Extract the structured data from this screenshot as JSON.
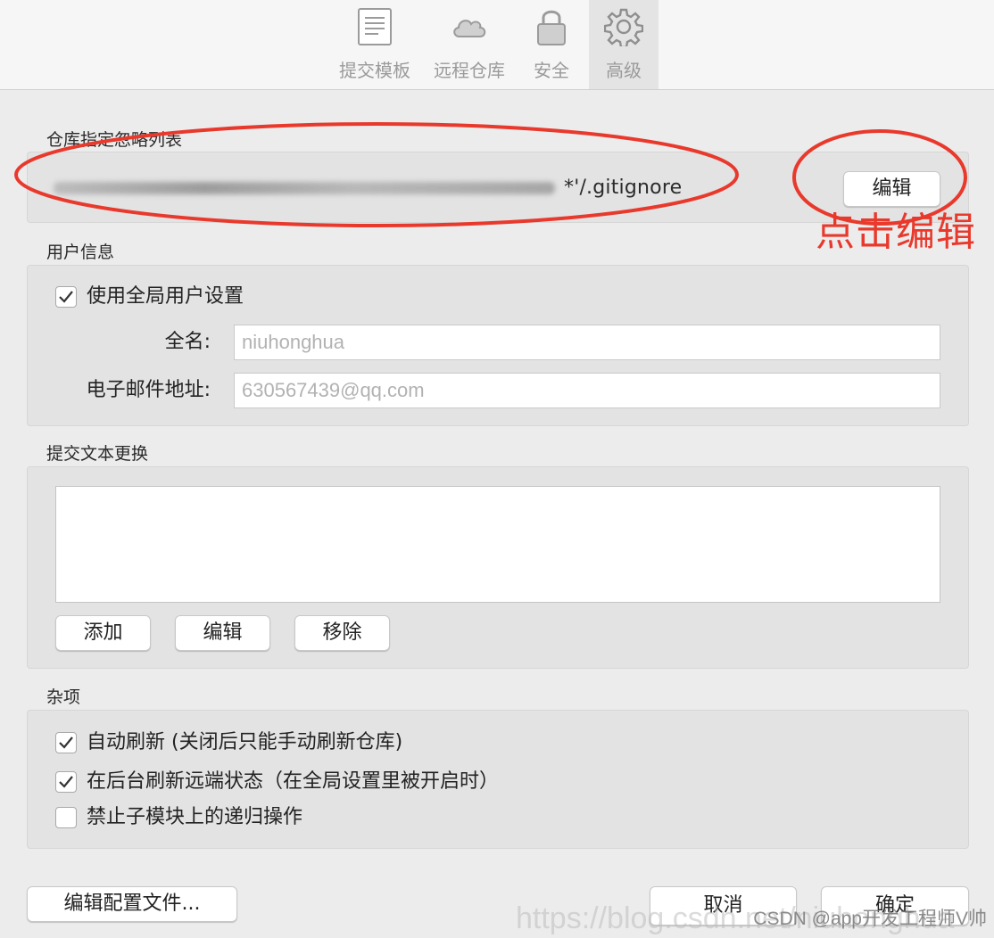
{
  "toolbar": {
    "tabs": [
      {
        "label": "提交模板",
        "icon": "document-icon"
      },
      {
        "label": "远程仓库",
        "icon": "cloud-icon"
      },
      {
        "label": "安全",
        "icon": "lock-icon"
      },
      {
        "label": "高级",
        "icon": "gear-icon",
        "active": true
      }
    ]
  },
  "ignore": {
    "label": "仓库指定忽略列表",
    "path_suffix": "*'/.gitignore",
    "edit_label": "编辑"
  },
  "annotation": {
    "text": "点击编辑",
    "color": "#e8392c"
  },
  "user": {
    "label": "用户信息",
    "use_global": "使用全局用户设置",
    "use_global_checked": true,
    "fullname_label": "全名:",
    "fullname_value": "niuhonghua",
    "email_label": "电子邮件地址:",
    "email_value": "630567439@qq.com"
  },
  "commit_text": {
    "label": "提交文本更换",
    "add": "添加",
    "edit": "编辑",
    "remove": "移除"
  },
  "misc": {
    "label": "杂项",
    "options": [
      {
        "text": "自动刷新 (关闭后只能手动刷新仓库)",
        "checked": true
      },
      {
        "text": "在后台刷新远端状态（在全局设置里被开启时）",
        "checked": true
      },
      {
        "text": "禁止子模块上的递归操作",
        "checked": false
      }
    ]
  },
  "footer": {
    "edit_config": "编辑配置文件...",
    "cancel": "取消",
    "ok": "确定"
  },
  "watermark": {
    "url": "https://blog.csdn.net/niuhonghua",
    "credit": "CSDN @app开发工程师V帅"
  }
}
